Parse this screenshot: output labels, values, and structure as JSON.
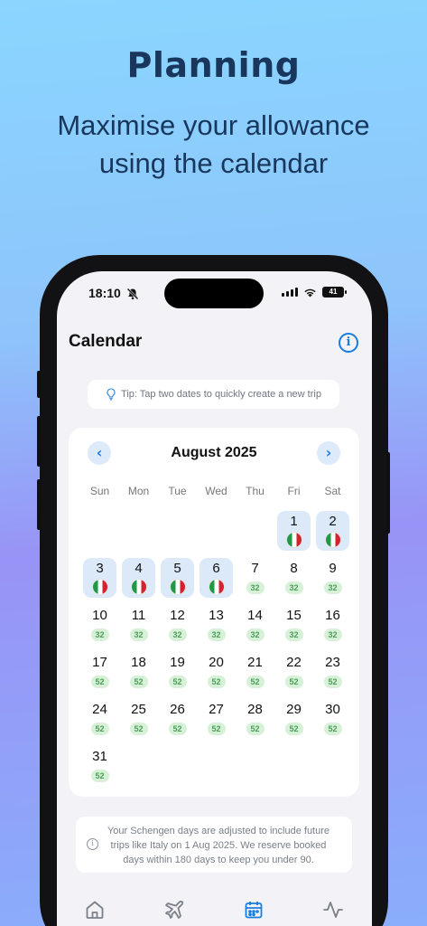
{
  "promo": {
    "headline": "Planning",
    "subheadline": "Maximise your allowance using the calendar"
  },
  "status_bar": {
    "time": "18:10",
    "battery": "41"
  },
  "header": {
    "title": "Calendar"
  },
  "tip": {
    "text": "Tip: Tap two dates to quickly create a new trip"
  },
  "calendar": {
    "month_label": "August 2025",
    "prev_icon": "chevron-left-icon",
    "next_icon": "chevron-right-icon",
    "weekdays": [
      "Sun",
      "Mon",
      "Tue",
      "Wed",
      "Thu",
      "Fri",
      "Sat"
    ],
    "first_weekday_index": 5,
    "days": [
      {
        "day": "1",
        "trip": "italy-flag"
      },
      {
        "day": "2",
        "trip": "italy-flag"
      },
      {
        "day": "3",
        "trip": "italy-flag"
      },
      {
        "day": "4",
        "trip": "italy-flag"
      },
      {
        "day": "5",
        "trip": "italy-flag"
      },
      {
        "day": "6",
        "trip": "italy-flag"
      },
      {
        "day": "7",
        "remaining": "32"
      },
      {
        "day": "8",
        "remaining": "32"
      },
      {
        "day": "9",
        "remaining": "32"
      },
      {
        "day": "10",
        "remaining": "32"
      },
      {
        "day": "11",
        "remaining": "32"
      },
      {
        "day": "12",
        "remaining": "32"
      },
      {
        "day": "13",
        "remaining": "32"
      },
      {
        "day": "14",
        "remaining": "32"
      },
      {
        "day": "15",
        "remaining": "32"
      },
      {
        "day": "16",
        "remaining": "32"
      },
      {
        "day": "17",
        "remaining": "52"
      },
      {
        "day": "18",
        "remaining": "52"
      },
      {
        "day": "19",
        "remaining": "52"
      },
      {
        "day": "20",
        "remaining": "52"
      },
      {
        "day": "21",
        "remaining": "52"
      },
      {
        "day": "22",
        "remaining": "52"
      },
      {
        "day": "23",
        "remaining": "52"
      },
      {
        "day": "24",
        "remaining": "52"
      },
      {
        "day": "25",
        "remaining": "52"
      },
      {
        "day": "26",
        "remaining": "52"
      },
      {
        "day": "27",
        "remaining": "52"
      },
      {
        "day": "28",
        "remaining": "52"
      },
      {
        "day": "29",
        "remaining": "52"
      },
      {
        "day": "30",
        "remaining": "52"
      },
      {
        "day": "31",
        "remaining": "52"
      }
    ]
  },
  "note": {
    "text": "Your Schengen days are adjusted to include future trips like Italy on 1 Aug 2025. We reserve booked days within 180 days to keep you under 90."
  },
  "tab_bar": {
    "items": [
      {
        "icon": "home-icon"
      },
      {
        "icon": "plane-icon"
      },
      {
        "icon": "calendar-icon",
        "active": true
      },
      {
        "icon": "activity-icon"
      }
    ],
    "colors": {
      "active": "#1a7ee0",
      "inactive": "#7c8088"
    }
  },
  "colors": {
    "accent": "#1a7ee0",
    "booked_bg": "#dbe9f9",
    "badge_bg": "#d6f1d8",
    "badge_text": "#4c9e57",
    "headline": "#19375c"
  }
}
